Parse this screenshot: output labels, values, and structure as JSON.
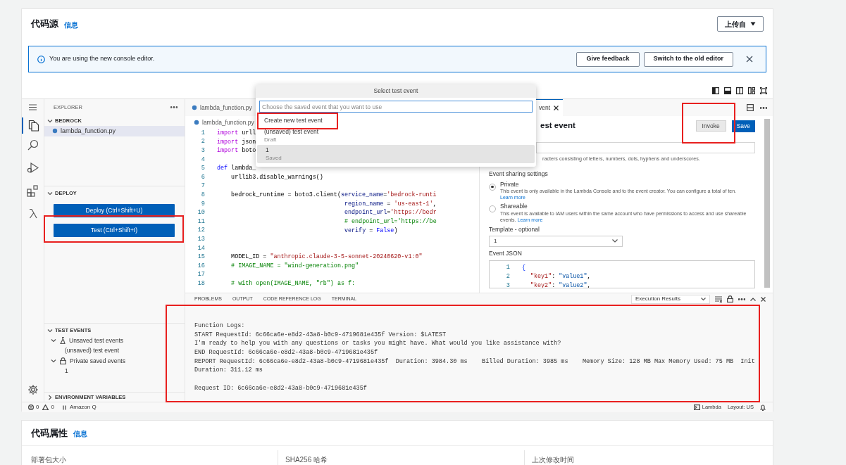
{
  "code_source": {
    "title": "代码源",
    "info_link": "信息",
    "upload_button": "上传自"
  },
  "banner": {
    "message": "You are using the new console editor.",
    "buttons": [
      "Give feedback",
      "Switch to the old editor"
    ]
  },
  "explorer": {
    "title": "EXPLORER",
    "folder": {
      "label": "BEDROCK",
      "expanded": true,
      "files": [
        {
          "label": "lambda_function.py",
          "selected": true
        }
      ]
    },
    "deploy": {
      "label": "DEPLOY",
      "expanded": true,
      "buttons": [
        "Deploy (Ctrl+Shift+U)",
        "Test (Ctrl+Shift+I)"
      ]
    },
    "test_events": {
      "label": "TEST EVENTS",
      "expanded": true,
      "tree": [
        {
          "kind": "unsaved",
          "label": "Unsaved test events",
          "expanded": true,
          "children": [
            {
              "label": "(unsaved) test event"
            }
          ]
        },
        {
          "kind": "private",
          "label": "Private saved events",
          "expanded": true,
          "children": [
            {
              "label": "1"
            }
          ]
        }
      ]
    },
    "env_vars": {
      "label": "ENVIRONMENT VARIABLES",
      "expanded": false
    }
  },
  "editor": {
    "tab": "lambda_function.py",
    "breadcrumb": "lambda_function.py",
    "lines": [
      {
        "number": "1",
        "tokens": [
          {
            "kind": "keyword",
            "text": "import"
          },
          {
            "kind": "plain",
            "text": " urll"
          }
        ]
      },
      {
        "number": "2",
        "tokens": [
          {
            "kind": "keyword",
            "text": "import"
          },
          {
            "kind": "plain",
            "text": " json"
          }
        ]
      },
      {
        "number": "3",
        "tokens": [
          {
            "kind": "keyword",
            "text": "import"
          },
          {
            "kind": "plain",
            "text": " boto"
          }
        ]
      },
      {
        "number": "4"
      },
      {
        "number": "5",
        "tokens": [
          {
            "kind": "def",
            "text": "def"
          },
          {
            "kind": "plain",
            "text": " lambda_"
          }
        ]
      },
      {
        "number": "6",
        "tokens": [
          {
            "kind": "plain",
            "text": "    urllib3.disable_warnings()"
          }
        ]
      },
      {
        "number": "7"
      },
      {
        "number": "8",
        "tokens": [
          {
            "kind": "plain",
            "text": "    bedrock_runtime = boto3.client("
          },
          {
            "kind": "param",
            "text": "service_name"
          },
          {
            "kind": "plain",
            "text": "="
          },
          {
            "kind": "string",
            "text": "'bedrock-runti"
          }
        ]
      },
      {
        "number": "9",
        "continuation": true,
        "tokens": [
          {
            "kind": "param",
            "text": "region_name"
          },
          {
            "kind": "plain",
            "text": " = "
          },
          {
            "kind": "string",
            "text": "'us-east-1'"
          },
          {
            "kind": "plain",
            "text": ","
          }
        ]
      },
      {
        "number": "10",
        "continuation": true,
        "tokens": [
          {
            "kind": "param",
            "text": "endpoint_url"
          },
          {
            "kind": "plain",
            "text": "="
          },
          {
            "kind": "string",
            "text": "'https://bedr"
          }
        ]
      },
      {
        "number": "11",
        "continuation": true,
        "tokens": [
          {
            "kind": "comment",
            "text": "# endpoint_url='https://be"
          }
        ]
      },
      {
        "number": "12",
        "continuation": true,
        "tokens": [
          {
            "kind": "param",
            "text": "verify"
          },
          {
            "kind": "plain",
            "text": " = "
          },
          {
            "kind": "def",
            "text": "False"
          },
          {
            "kind": "plain",
            "text": ")"
          }
        ]
      },
      {
        "number": "13"
      },
      {
        "number": "14"
      },
      {
        "number": "15",
        "tokens": [
          {
            "kind": "plain",
            "text": "    MODEL_ID = "
          },
          {
            "kind": "string",
            "text": "\"anthropic.claude-3-5-sonnet-20240620-v1:0\""
          }
        ]
      },
      {
        "number": "16",
        "tokens": [
          {
            "kind": "comment",
            "text": "    # IMAGE_NAME = \"wind-generation.png\""
          }
        ]
      },
      {
        "number": "17"
      },
      {
        "number": "18",
        "tokens": [
          {
            "kind": "comment",
            "text": "    # with open(IMAGE_NAME, \"rb\") as f:"
          }
        ]
      }
    ]
  },
  "test_panel": {
    "tab": "vent",
    "heading": "est event",
    "invoke_button": "Invoke",
    "save_button": "Save",
    "name_hint": "racters consisting of letters, numbers, dots, hyphens and underscores.",
    "sharing_label": "Event sharing settings",
    "sharing_options": [
      {
        "label": "Private",
        "selected": true,
        "description": "This event is only available in the Lambda Console and to the event creator. You can configure a total of ten.",
        "link": "Learn more"
      },
      {
        "label": "Shareable",
        "selected": false,
        "description": "This event is available to IAM users within the same account who have permissions to access and use shareable events.",
        "link": "Learn more"
      }
    ],
    "template_label": "Template - optional",
    "template_value": "1",
    "json_label": "Event JSON",
    "json_lines": [
      {
        "number": "1",
        "tokens": [
          {
            "kind": "brace",
            "text": "{"
          }
        ]
      },
      {
        "number": "2",
        "nested": true,
        "tokens": [
          {
            "kind": "key",
            "text": "\"key1\""
          },
          {
            "kind": "plain",
            "text": ": "
          },
          {
            "kind": "value",
            "text": "\"value1\""
          },
          {
            "kind": "plain",
            "text": ","
          }
        ]
      },
      {
        "number": "3",
        "nested": true,
        "tokens": [
          {
            "kind": "key",
            "text": "\"key2\""
          },
          {
            "kind": "plain",
            "text": ": "
          },
          {
            "kind": "value",
            "text": "\"value2\""
          },
          {
            "kind": "plain",
            "text": ","
          }
        ]
      }
    ]
  },
  "event_picker": {
    "title": "Select test event",
    "placeholder": "Choose the saved event that you want to use",
    "items": [
      {
        "label": "Create new test event",
        "selected": false
      },
      {
        "label": "(unsaved) test event",
        "detail": "Draft",
        "selected": false
      },
      {
        "label": "1",
        "detail": "Saved",
        "selected": true
      }
    ]
  },
  "output_panel": {
    "tabs": [
      "PROBLEMS",
      "OUTPUT",
      "CODE REFERENCE LOG",
      "TERMINAL"
    ],
    "channel": "Execution Results",
    "lines": [
      "Function Logs:",
      "START RequestId: 6c66ca6e-e8d2-43a8-b0c9-4719681e435f Version: $LATEST",
      "I'm ready to help you with any questions or tasks you might have. What would you like assistance with?",
      "END RequestId: 6c66ca6e-e8d2-43a8-b0c9-4719681e435f",
      "REPORT RequestId: 6c66ca6e-e8d2-43a8-b0c9-4719681e435f  Duration: 3984.30 ms    Billed Duration: 3985 ms    Memory Size: 128 MB Max Memory Used: 75 MB  Init",
      "Duration: 311.12 ms"
    ],
    "request_line": "Request ID: 6c66ca6e-e8d2-43a8-b0c9-4719681e435f"
  },
  "status_bar": {
    "errors": "0",
    "warnings": "0",
    "assistant": "Amazon Q",
    "right": [
      "Lambda",
      "Layout: US"
    ]
  },
  "code_properties": {
    "title": "代码属性",
    "info_link": "信息",
    "columns": [
      "部署包大小",
      "SHA256 哈希",
      "上次修改时间"
    ]
  }
}
